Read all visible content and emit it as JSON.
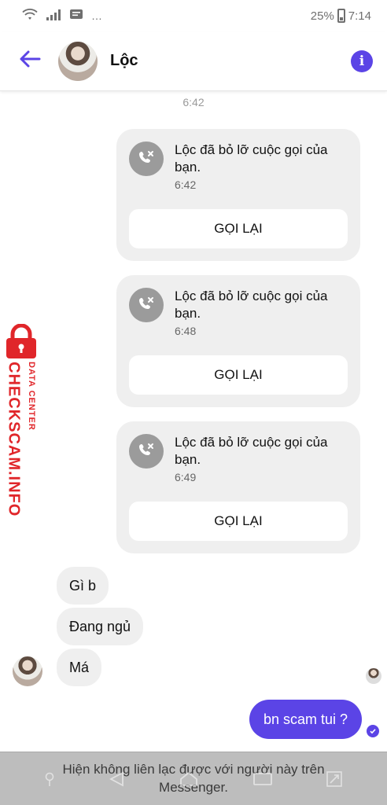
{
  "status_bar": {
    "battery": "25%",
    "time": "7:14",
    "icons": [
      "wifi-icon",
      "signal-icon",
      "message-notification-icon",
      "more-icon"
    ]
  },
  "header": {
    "contact_name": "Lộc",
    "back_icon": "arrow-left-icon",
    "info_icon": "info-icon",
    "accent_color": "#5b44e6"
  },
  "chat": {
    "top_time": "6:42",
    "missed_calls": [
      {
        "text": "Lộc đã bỏ lỡ cuộc gọi của bạn.",
        "time": "6:42",
        "button": "GỌI LẠI"
      },
      {
        "text": "Lộc đã bỏ lỡ cuộc gọi của bạn.",
        "time": "6:48",
        "button": "GỌI LẠI"
      },
      {
        "text": "Lộc đã bỏ lỡ cuộc gọi của bạn.",
        "time": "6:49",
        "button": "GỌI LẠI"
      }
    ],
    "incoming": [
      "Gì b",
      "Đang ngủ",
      "Má"
    ],
    "outgoing": "bn scam tui ?"
  },
  "watermark": {
    "main": "CHECKSCAM.INFO",
    "sub": "DATA CENTER",
    "color": "#e0262a"
  },
  "bottom": {
    "notice": "Hiện không liên lạc được với người này trên Messenger."
  }
}
